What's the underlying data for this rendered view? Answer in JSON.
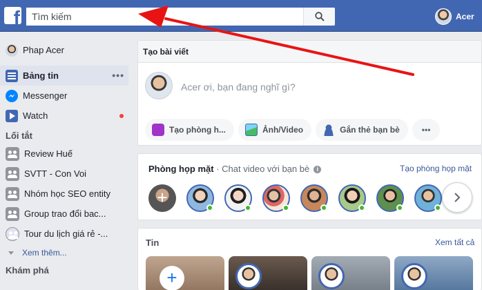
{
  "topbar": {
    "logo_letter": "f",
    "search_placeholder": "Tìm kiếm",
    "user_name": "Acer"
  },
  "sidebar": {
    "profile_name": "Phap Acer",
    "items": [
      {
        "label": "Bảng tin",
        "icon": "news-feed-icon"
      },
      {
        "label": "Messenger",
        "icon": "messenger-icon"
      },
      {
        "label": "Watch",
        "icon": "watch-icon"
      }
    ],
    "shortcuts_title": "Lối tắt",
    "shortcuts": [
      "Review Huế",
      "SVTT - Con Voi",
      "Nhóm học SEO entity",
      "Group trao đổi bac...",
      "Tour du lịch giá rẻ -..."
    ],
    "see_more": "Xem thêm...",
    "explore_title": "Khám phá"
  },
  "composer": {
    "title": "Tạo bài viết",
    "placeholder": "Acer ơi, bạn đang nghĩ gì?",
    "actions": [
      "Tạo phòng h...",
      "Ảnh/Video",
      "Gắn thẻ bạn bè"
    ],
    "more": "•••"
  },
  "rooms": {
    "title": "Phòng họp mặt",
    "subtitle": " · Chat video với bạn bè",
    "create_link": "Tạo phòng họp mặt",
    "add": "+"
  },
  "stories": {
    "title": "Tin",
    "see_all": "Xem tất cả",
    "add": "+"
  },
  "colors": {
    "brand_blue": "#4267b2",
    "online_green": "#42b72a",
    "arrow_red": "#e81414"
  }
}
